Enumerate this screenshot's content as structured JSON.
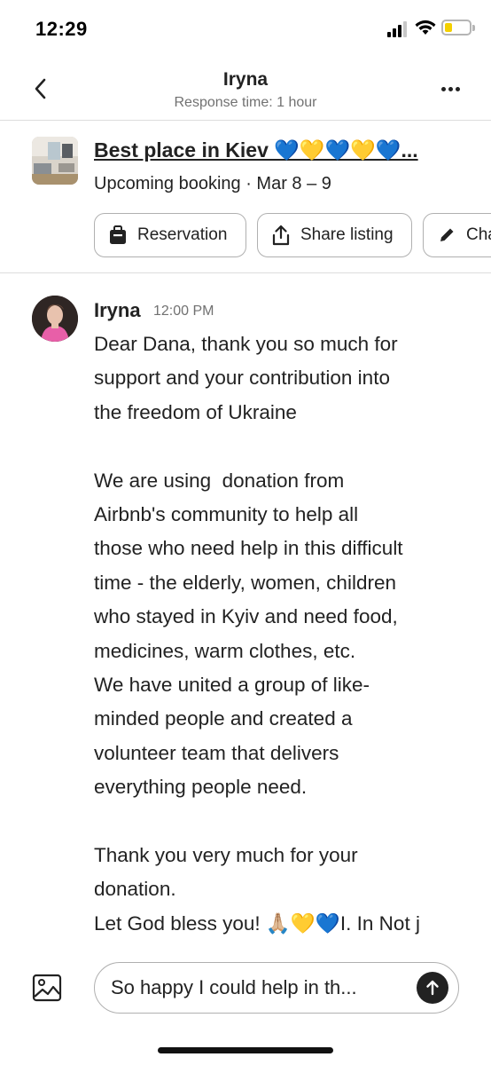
{
  "status_bar": {
    "time": "12:29",
    "signal_icon": "cellular-signal-icon",
    "wifi_icon": "wifi-icon",
    "battery_icon": "battery-low-icon",
    "battery_level": 0.3,
    "battery_color": "#f4d000"
  },
  "header": {
    "title": "Iryna",
    "subtitle": "Response time: 1 hour",
    "back_icon": "chevron-left-icon",
    "more_icon": "more-horizontal-icon"
  },
  "listing": {
    "name": "Best place in Kiev 💙💛💙💛💙...",
    "booking": "Upcoming booking · Mar 8 – 9",
    "thumbnail_icon": "listing-photo",
    "chips": [
      {
        "label": "Reservation",
        "icon": "suitcase-icon"
      },
      {
        "label": "Share listing",
        "icon": "share-icon"
      },
      {
        "label": "Cha",
        "icon": "pencil-icon"
      }
    ]
  },
  "message": {
    "sender": "Iryna",
    "time": "12:00 PM",
    "lines": [
      "Dear Dana, thank you so much for",
      "support and your contribution into",
      "the freedom of Ukraine",
      "",
      "We are using  donation from",
      "Airbnb's community to help all",
      "those who need help in this difficult",
      "time - the elderly, women, children",
      "who stayed in Kyiv and need food,",
      "medicines, warm clothes, etc.",
      "We have united a group of like-",
      "minded people and created a",
      "volunteer team that delivers",
      "everything people need.",
      "",
      "Thank you very much for your",
      "donation.",
      "Let God bless you! 🙏🏼💛💙I. In Not j"
    ]
  },
  "composer": {
    "value": "So happy I could help in th...",
    "image_icon": "image-icon",
    "send_icon": "arrow-up-icon"
  },
  "colors": {
    "text": "#222222",
    "secondary_text": "#717171",
    "divider": "#dddddd",
    "border": "#b0b0b0"
  }
}
